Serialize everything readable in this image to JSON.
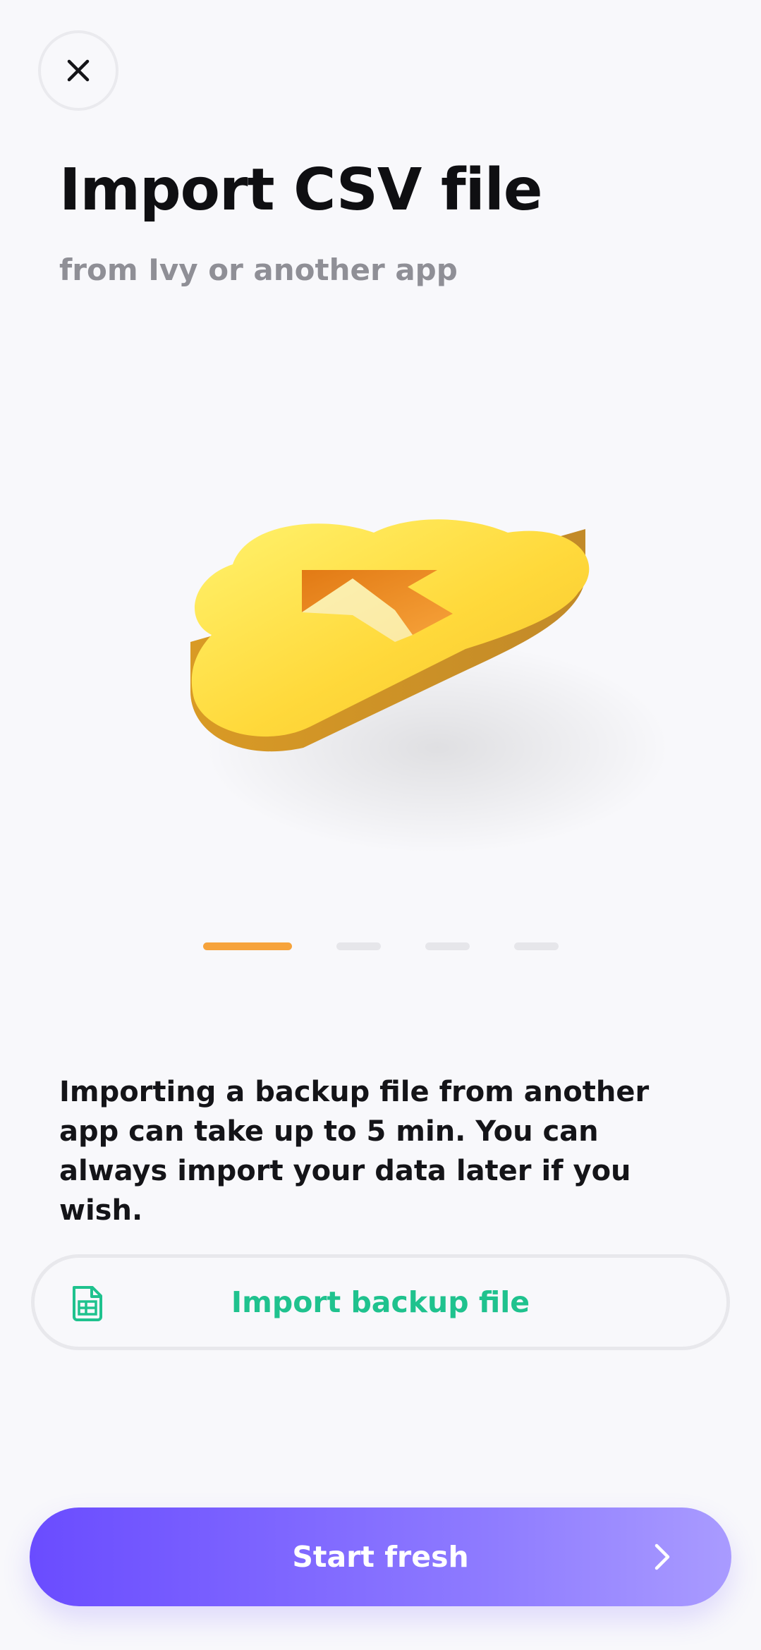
{
  "header": {
    "title": "Import CSV file",
    "subtitle": "from Ivy or another app"
  },
  "illustration": {
    "icon": "cloud-import-icon",
    "colors": {
      "cloud": "#FFD93B",
      "arrow": "#F39C1F"
    }
  },
  "pager": {
    "page_count": 4,
    "active_index": 0,
    "active_color": "#F6A33B",
    "inactive_color": "#E6E6EA"
  },
  "body": {
    "description": "Importing a backup file from another app can take up to 5 min. You can always import your data later if you wish."
  },
  "actions": {
    "import_label": "Import backup file",
    "import_icon": "spreadsheet-file-icon",
    "import_color": "#1FC28E",
    "start_label": "Start fresh",
    "start_icon": "chevron-right-icon",
    "start_gradient": [
      "#6A4CFF",
      "#A99BFF"
    ]
  },
  "close_icon": "close-icon"
}
